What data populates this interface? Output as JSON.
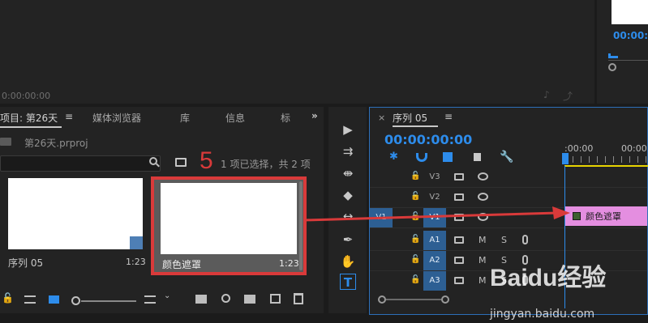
{
  "top_monitor": {
    "timecode": "0:00:00:00"
  },
  "program_monitor": {
    "timecode": "00:00:"
  },
  "project_panel": {
    "tabs": [
      "项目: 第26天",
      "媒体浏览器",
      "库",
      "信息",
      "标"
    ],
    "menu_glyph": "≡",
    "more_glyph": "»",
    "file": "第26天.prproj",
    "selection_info": "1 项已选择，共 2 项",
    "clips": [
      {
        "name": "序列 05",
        "duration": "1:23"
      },
      {
        "name": "颜色遮罩",
        "duration": "1:23"
      }
    ],
    "step_number": "5"
  },
  "tools": {
    "selection": "▶",
    "track_select": "⇉",
    "ripple": "⇼",
    "razor": "◆",
    "slip": "↔",
    "pen": "✒",
    "hand": "✋",
    "type": "T"
  },
  "timeline": {
    "close": "×",
    "title": "序列 05",
    "menu_glyph": "≡",
    "timecode": "00:00:00:00",
    "ruler": [
      ":00:00",
      "00:00"
    ],
    "tracks": [
      {
        "source": "",
        "target": "V3",
        "kind": "video"
      },
      {
        "source": "",
        "target": "V2",
        "kind": "video"
      },
      {
        "source": "V1",
        "target": "V1",
        "kind": "video"
      },
      {
        "source": "",
        "target": "A1",
        "kind": "audio"
      },
      {
        "source": "",
        "target": "A2",
        "kind": "audio"
      },
      {
        "source": "",
        "target": "A3",
        "kind": "audio"
      }
    ],
    "clip_label": "颜色遮罩",
    "mute_label": "M",
    "solo_label": "S",
    "lock_glyph": "🔓"
  },
  "watermark": {
    "logo": "Baidu经验",
    "url": "jingyan.baidu.com"
  },
  "colors": {
    "accent": "#2d8ceb",
    "highlight_frame": "#d93a3a",
    "clip_pink": "#e48ee0"
  }
}
